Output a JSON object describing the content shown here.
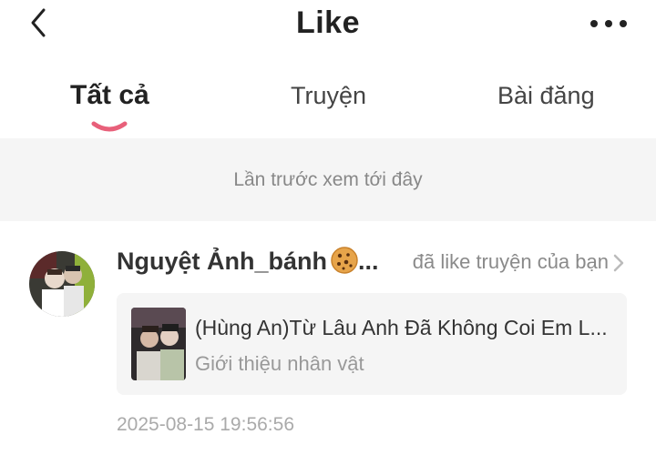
{
  "header": {
    "title": "Like",
    "back_icon": "chevron-left-icon",
    "more_icon": "more-dots-icon"
  },
  "tabs": [
    {
      "label": "Tất cả",
      "active": true
    },
    {
      "label": "Truyện",
      "active": false
    },
    {
      "label": "Bài đăng",
      "active": false
    }
  ],
  "accent_color": "#e8607a",
  "notice": {
    "text": "Lần trước xem tới đây"
  },
  "notifications": [
    {
      "user_name": "Nguyệt Ảnh_bánh",
      "name_emoji": "cookie",
      "name_ellipsis": "...",
      "action": "đã like truyện của bạn",
      "story": {
        "title": "(Hùng An)Từ Lâu Anh Đã Không Coi Em L...",
        "subtitle": "Giới thiệu nhân vật"
      },
      "timestamp": "2025-08-15 19:56:56"
    }
  ]
}
